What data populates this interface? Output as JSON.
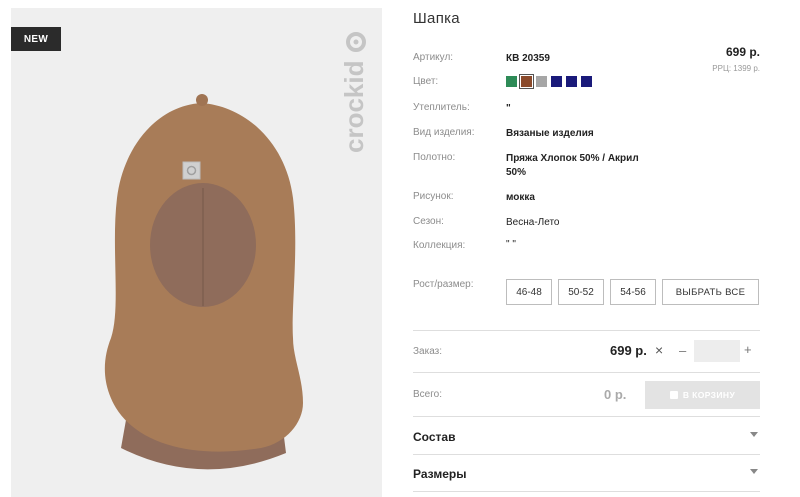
{
  "product": {
    "badge": "NEW",
    "brand": "crockid",
    "title": "Шапка",
    "price": "699 р.",
    "rrc_price": "РРЦ: 1399 р."
  },
  "attributes": {
    "article": {
      "label": "Артикул:",
      "value": "КВ 20359"
    },
    "color": {
      "label": "Цвет:",
      "swatches": [
        "#2e8b57",
        "#8b4a2b",
        "#a6a6a6",
        "#1a1a7a",
        "#1a1a7a",
        "#1a1a7a"
      ],
      "selected_index": 1
    },
    "insulation": {
      "label": "Утеплитель:",
      "value": "\""
    },
    "type": {
      "label": "Вид изделия:",
      "value": "Вязаные изделия"
    },
    "fabric": {
      "label": "Полотно:",
      "value": "Пряжа Хлопок 50% / Акрил 50%"
    },
    "pattern": {
      "label": "Рисунок:",
      "value": "мокка"
    },
    "season": {
      "label": "Сезон:",
      "value": "Весна-Лето"
    },
    "collection": {
      "label": "Коллекция:",
      "value": "\" \""
    },
    "size": {
      "label": "Рост/размер:",
      "options": [
        "46-48",
        "50-52",
        "54-56"
      ],
      "select_all": "ВЫБРАТЬ ВСЕ"
    }
  },
  "order": {
    "label": "Заказ:",
    "price": "699 р.",
    "remove_symbol": "×",
    "minus_symbol": "–",
    "plus_symbol": "+",
    "quantity": ""
  },
  "total": {
    "label": "Всего:",
    "value": "0 р.",
    "cart_button": "В КОРЗИНУ"
  },
  "accordions": {
    "composition": "Состав",
    "sizes": "Размеры"
  },
  "colors": {
    "product_knit": "#a87c58",
    "product_inner": "#8f6c5b",
    "background": "#efefef",
    "cart_button_bg": "#e3e3e3"
  }
}
